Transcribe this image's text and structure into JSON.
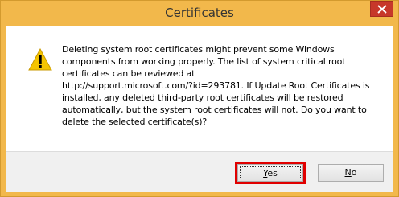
{
  "window": {
    "title": "Certificates",
    "close_symbol": "×"
  },
  "dialog": {
    "icon": "warning-icon",
    "message_lines": [
      "Deleting system root certificates might prevent some Windows",
      "components from working properly. The list of system critical root",
      "certificates can be reviewed at",
      "http://support.microsoft.com/?id=293781. If Update Root Certificates is",
      "installed, any deleted third-party root certificates will be restored",
      "automatically, but the system root certificates will not. Do you want to",
      "delete the selected certificate(s)?"
    ]
  },
  "buttons": {
    "yes": {
      "mnemonic": "Y",
      "rest": "es"
    },
    "no": {
      "mnemonic": "N",
      "rest": "o"
    }
  },
  "colors": {
    "titlebar": "#f2b84b",
    "close": "#c7382a",
    "highlight": "#e00000",
    "warning": "#f5c400"
  }
}
